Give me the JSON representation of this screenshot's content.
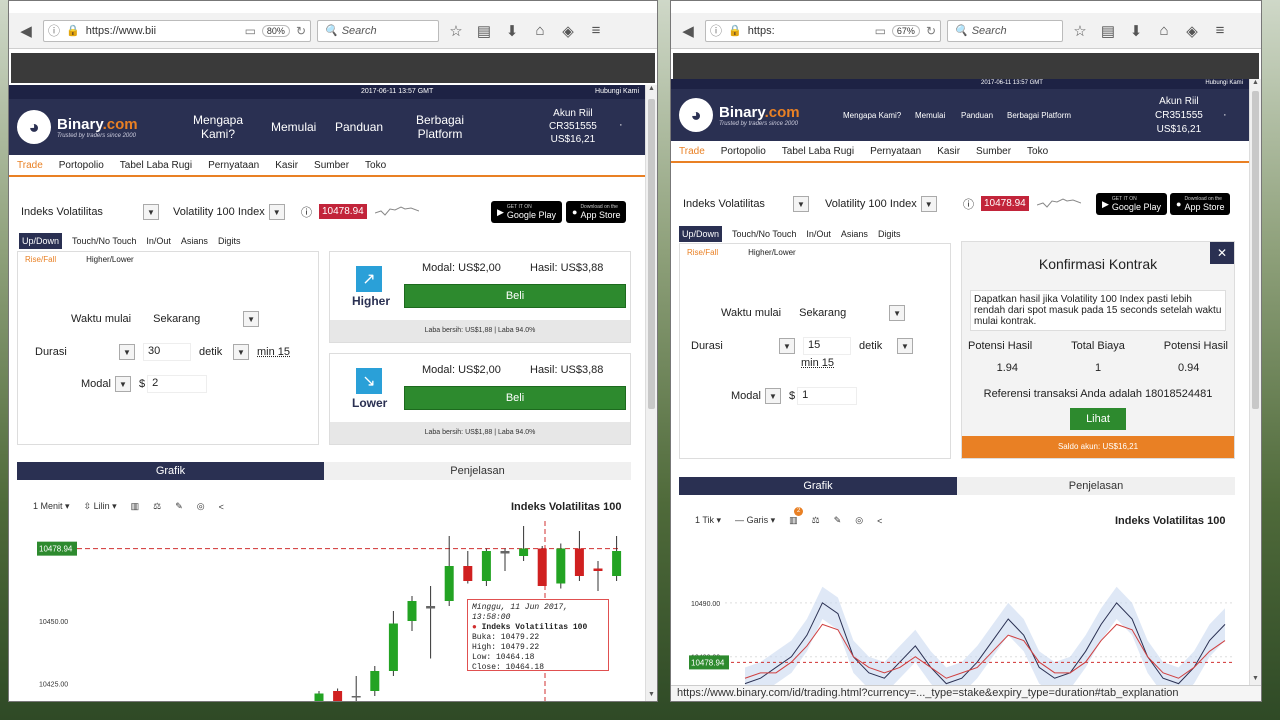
{
  "left": {
    "url": "https://www.bii",
    "zoom": "80%",
    "search_placeholder": "Search",
    "datetime": "2017-06-11 13:57 GMT",
    "contact": "Hubungi Kami",
    "brand": {
      "name_a": "Binary",
      "name_b": ".com",
      "tagline": "Trusted by traders since 2000"
    },
    "nav": [
      {
        "label": "Mengapa\nKami?"
      },
      {
        "label": "Memulai"
      },
      {
        "label": "Panduan"
      },
      {
        "label": "Berbagai\nPlatform"
      }
    ],
    "account": {
      "type": "Akun Riil",
      "id": "CR351555",
      "balance": "US$16,21",
      "caret": "·"
    },
    "subnav": [
      "Trade",
      "Portopolio",
      "Tabel Laba Rugi",
      "Pernyataan",
      "Kasir",
      "Sumber",
      "Toko"
    ],
    "market": "Indeks Volatilitas",
    "submarket": "Volatility 100 Index",
    "info_icon": "ⓘ",
    "price": "10478.94",
    "store_google": {
      "small": "GET IT ON",
      "label": "Google Play"
    },
    "store_apple": {
      "small": "Download on the",
      "label": "App Store"
    },
    "trade_tabs": [
      "Up/Down",
      "Touch/No Touch",
      "In/Out",
      "Asians",
      "Digits"
    ],
    "sub_tabs": [
      "Rise/Fall",
      "Higher/Lower"
    ],
    "form": {
      "start_label": "Waktu mulai",
      "start_value": "Sekarang",
      "duration_label": "Durasi",
      "duration_value": "30",
      "duration_unit": "detik",
      "duration_min": "min 15",
      "stake_label": "Modal",
      "stake_currency": "$",
      "stake_value": "2"
    },
    "higher": {
      "label": "Higher",
      "stake_k": "Modal:",
      "stake_v": "US$2,00",
      "payout_k": "Hasil:",
      "payout_v": "US$3,88",
      "buy": "Beli",
      "footer": "Laba bersih: US$1,88 | Laba 94.0%"
    },
    "lower": {
      "label": "Lower",
      "stake_k": "Modal:",
      "stake_v": "US$2,00",
      "payout_k": "Hasil:",
      "payout_v": "US$3,88",
      "buy": "Beli",
      "footer": "Laba bersih: US$1,88 | Laba 94.0%"
    },
    "chart_tabs": [
      "Grafik",
      "Penjelasan"
    ],
    "chart_toolbar": {
      "interval": "1 Menit",
      "type": "Lilin"
    },
    "chart_title": "Indeks Volatilitas 100",
    "current_price_tag": "10478.94",
    "tooltip": {
      "date": "Minggu, 11 Jun 2017, 13:58:00",
      "series": "Indeks Volatilitas 100",
      "open": "Buka: 10479.22",
      "high": "High: 10479.22",
      "low": "Low: 10464.18",
      "close": "Close: 10464.18"
    }
  },
  "right": {
    "url": "https:",
    "zoom": "67%",
    "search_placeholder": "Search",
    "datetime": "2017-06-11 13:57 GMT",
    "contact": "Hubungi Kami",
    "brand": {
      "name_a": "Binary",
      "name_b": ".com",
      "tagline": "Trusted by traders since 2000"
    },
    "nav": [
      {
        "label": "Mengapa Kami?"
      },
      {
        "label": "Memulai"
      },
      {
        "label": "Panduan"
      },
      {
        "label": "Berbagai Platform"
      }
    ],
    "account": {
      "type": "Akun Riil",
      "id": "CR351555",
      "balance": "US$16,21",
      "caret": "·"
    },
    "subnav": [
      "Trade",
      "Portopolio",
      "Tabel Laba Rugi",
      "Pernyataan",
      "Kasir",
      "Sumber",
      "Toko"
    ],
    "market": "Indeks Volatilitas",
    "submarket": "Volatility 100 Index",
    "info_icon": "ⓘ",
    "price": "10478.94",
    "store_google": {
      "small": "GET IT ON",
      "label": "Google Play"
    },
    "store_apple": {
      "small": "Download on the",
      "label": "App Store"
    },
    "trade_tabs": [
      "Up/Down",
      "Touch/No Touch",
      "In/Out",
      "Asians",
      "Digits"
    ],
    "sub_tabs": [
      "Rise/Fall",
      "Higher/Lower"
    ],
    "form": {
      "start_label": "Waktu mulai",
      "start_value": "Sekarang",
      "duration_label": "Durasi",
      "duration_value": "15",
      "duration_unit": "detik",
      "duration_min": "min 15",
      "stake_label": "Modal",
      "stake_currency": "$",
      "stake_value": "1"
    },
    "confirm": {
      "title": "Konfirmasi Kontrak",
      "close": "✕",
      "desc": "Dapatkan hasil jika Volatility 100 Index pasti lebih rendah dari spot masuk pada 15 seconds setelah waktu mulai kontrak.",
      "cols": [
        "Potensi Hasil",
        "Total Biaya",
        "Potensi Hasil"
      ],
      "vals": [
        "1.94",
        "1",
        "0.94"
      ],
      "ref": "Referensi transaksi Anda adalah 18018524481",
      "view": "Lihat",
      "balance": "Saldo akun: US$16,21"
    },
    "chart_tabs": [
      "Grafik",
      "Penjelasan"
    ],
    "chart_toolbar": {
      "interval": "1 Tik",
      "type": "Garis",
      "badge": "2"
    },
    "chart_title": "Indeks Volatilitas 100",
    "current_price_tag": "10478.94",
    "status_url": "https://www.binary.com/id/trading.html?currency=..._type=stake&expiry_type=duration#tab_explanation"
  },
  "chart_data": [
    {
      "type": "candlestick",
      "title": "Indeks Volatilitas 100",
      "y_ticks": [
        "10478.94",
        "10450.00",
        "10425.00"
      ],
      "ylim": [
        10418,
        10490
      ],
      "candles": [
        {
          "o": 10418,
          "h": 10422,
          "l": 10415,
          "c": 10421,
          "dir": "up"
        },
        {
          "o": 10422,
          "h": 10423,
          "l": 10416,
          "c": 10417,
          "dir": "down"
        },
        {
          "o": 10420,
          "h": 10428,
          "l": 10418,
          "c": 10420,
          "dir": "flat"
        },
        {
          "o": 10422,
          "h": 10432,
          "l": 10420,
          "c": 10430,
          "dir": "up"
        },
        {
          "o": 10430,
          "h": 10454,
          "l": 10428,
          "c": 10449,
          "dir": "up"
        },
        {
          "o": 10450,
          "h": 10460,
          "l": 10446,
          "c": 10458,
          "dir": "up"
        },
        {
          "o": 10455,
          "h": 10464,
          "l": 10435,
          "c": 10456,
          "dir": "flat"
        },
        {
          "o": 10458,
          "h": 10484,
          "l": 10456,
          "c": 10472,
          "dir": "up"
        },
        {
          "o": 10472,
          "h": 10478,
          "l": 10465,
          "c": 10466,
          "dir": "down"
        },
        {
          "o": 10466,
          "h": 10479,
          "l": 10464,
          "c": 10478,
          "dir": "up"
        },
        {
          "o": 10478,
          "h": 10479,
          "l": 10470,
          "c": 10477,
          "dir": "flat"
        },
        {
          "o": 10476,
          "h": 10488,
          "l": 10474,
          "c": 10479,
          "dir": "up"
        },
        {
          "o": 10479,
          "h": 10480,
          "l": 10464,
          "c": 10464,
          "dir": "down"
        },
        {
          "o": 10465,
          "h": 10481,
          "l": 10463,
          "c": 10479,
          "dir": "up"
        },
        {
          "o": 10479,
          "h": 10486,
          "l": 10466,
          "c": 10468,
          "dir": "down"
        },
        {
          "o": 10470,
          "h": 10474,
          "l": 10462,
          "c": 10471,
          "dir": "down"
        },
        {
          "o": 10468,
          "h": 10484,
          "l": 10466,
          "c": 10478,
          "dir": "up"
        }
      ]
    },
    {
      "type": "line",
      "title": "Indeks Volatilitas 100",
      "y_ticks": [
        "10490.00",
        "10480.00"
      ],
      "ylim": [
        10474,
        10500
      ],
      "series": [
        {
          "color": "#2a3052",
          "values": [
            10475,
            10476,
            10478,
            10480,
            10484,
            10490,
            10488,
            10480,
            10477,
            10476,
            10479,
            10482,
            10478,
            10475,
            10476,
            10479,
            10483,
            10487,
            10484,
            10478,
            10476,
            10477,
            10481,
            10486,
            10490,
            10487,
            10480,
            10476,
            10475,
            10478,
            10483,
            10486
          ]
        },
        {
          "color": "#d04040",
          "values": [
            10476,
            10477,
            10477,
            10479,
            10482,
            10486,
            10485,
            10480,
            10478,
            10477,
            10478,
            10480,
            10478,
            10476,
            10477,
            10478,
            10481,
            10484,
            10483,
            10479,
            10477,
            10477,
            10479,
            10483,
            10486,
            10485,
            10480,
            10477,
            10476,
            10478,
            10481,
            10483
          ]
        }
      ]
    }
  ]
}
